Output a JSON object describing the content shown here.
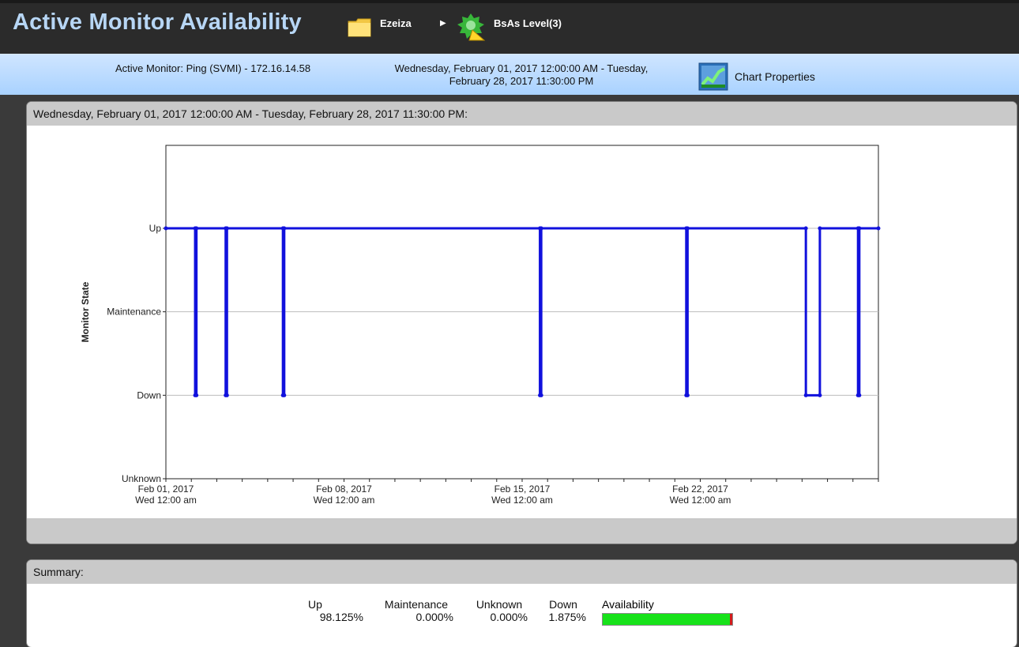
{
  "header": {
    "title": "Active Monitor Availability",
    "breadcrumbs": [
      {
        "label": "Ezeiza",
        "icon": "folder-icon"
      },
      {
        "label": "BsAs Level(3)",
        "icon": "device-status-icon"
      }
    ]
  },
  "infobar": {
    "monitor": "Active Monitor: Ping (SVMI) - 172.16.14.58",
    "range_line1": "Wednesday, February 01, 2017 12:00:00 AM - Tuesday,",
    "range_line2": "February 28, 2017 11:30:00 PM",
    "chart_properties_label": "Chart Properties",
    "chart_properties_icon": "chart-icon"
  },
  "chart_panel": {
    "header": "Wednesday, February 01, 2017 12:00:00 AM - Tuesday, February 28, 2017 11:30:00 PM:"
  },
  "chart_data": {
    "type": "line",
    "title": "",
    "xlabel": "",
    "ylabel": "Monitor State",
    "states": [
      "Unknown",
      "Down",
      "Maintenance",
      "Up"
    ],
    "x_ticks": [
      {
        "day": 1,
        "line1": "Feb 01, 2017",
        "line2": "Wed 12:00 am"
      },
      {
        "day": 8,
        "line1": "Feb 08, 2017",
        "line2": "Wed 12:00 am"
      },
      {
        "day": 15,
        "line1": "Feb 15, 2017",
        "line2": "Wed 12:00 am"
      },
      {
        "day": 22,
        "line1": "Feb 22, 2017",
        "line2": "Wed 12:00 am"
      }
    ],
    "xlim_days": [
      1,
      29
    ],
    "line_color": "#1111dd",
    "series": [
      {
        "values": [
          {
            "day": 1.0,
            "state": "Up"
          },
          {
            "day": 2.15,
            "state": "Up"
          },
          {
            "day": 2.15,
            "state": "Down"
          },
          {
            "day": 2.2,
            "state": "Down"
          },
          {
            "day": 2.2,
            "state": "Up"
          },
          {
            "day": 3.35,
            "state": "Up"
          },
          {
            "day": 3.35,
            "state": "Down"
          },
          {
            "day": 3.4,
            "state": "Down"
          },
          {
            "day": 3.4,
            "state": "Up"
          },
          {
            "day": 5.6,
            "state": "Up"
          },
          {
            "day": 5.6,
            "state": "Down"
          },
          {
            "day": 5.65,
            "state": "Down"
          },
          {
            "day": 5.65,
            "state": "Up"
          },
          {
            "day": 15.7,
            "state": "Up"
          },
          {
            "day": 15.7,
            "state": "Down"
          },
          {
            "day": 15.75,
            "state": "Down"
          },
          {
            "day": 15.75,
            "state": "Up"
          },
          {
            "day": 21.45,
            "state": "Up"
          },
          {
            "day": 21.45,
            "state": "Down"
          },
          {
            "day": 21.5,
            "state": "Down"
          },
          {
            "day": 21.5,
            "state": "Up"
          },
          {
            "day": 26.15,
            "state": "Up"
          },
          {
            "day": 26.15,
            "state": "Down"
          },
          {
            "day": 26.7,
            "state": "Down"
          },
          {
            "day": 26.7,
            "state": "Up"
          },
          {
            "day": 28.2,
            "state": "Up"
          },
          {
            "day": 28.2,
            "state": "Down"
          },
          {
            "day": 28.25,
            "state": "Down"
          },
          {
            "day": 28.25,
            "state": "Up"
          },
          {
            "day": 29.0,
            "state": "Up"
          }
        ]
      }
    ],
    "grid": true
  },
  "summary": {
    "header": "Summary:",
    "columns": [
      {
        "label": "Up",
        "value": "98.125%"
      },
      {
        "label": "Maintenance",
        "value": "0.000%"
      },
      {
        "label": "Unknown",
        "value": "0.000%"
      },
      {
        "label": "Down",
        "value": "1.875%"
      }
    ],
    "availability_label": "Availability",
    "availability_up_pct": 98.125,
    "up_color": "#17e21a",
    "down_color": "#d31b1b"
  }
}
